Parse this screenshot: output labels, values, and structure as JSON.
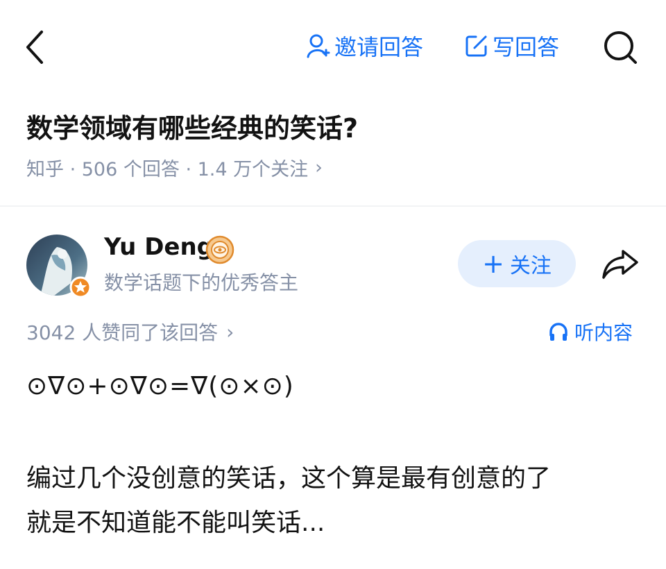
{
  "nav": {
    "invite_label": "邀请回答",
    "write_label": "写回答"
  },
  "question": {
    "title": "数学领域有哪些经典的笑话?",
    "meta": "知乎 · 506 个回答 · 1.4 万个关注",
    "meta_chevron": "›"
  },
  "author": {
    "name": "Yu Deng",
    "description": "数学话题下的优秀答主",
    "follow_label": "关注",
    "follow_plus": "+"
  },
  "answer": {
    "votes": "3042 人赞同了该回答",
    "votes_chevron": "›",
    "listen_label": "听内容",
    "formula": "⊙∇⊙+⊙∇⊙=∇(⊙×⊙)",
    "paragraph_line1": "编过几个没创意的笑话，这个算是最有创意的了",
    "paragraph_line2": "就是不知道能不能叫笑话..."
  },
  "colors": {
    "accent": "#1772f6",
    "muted_text": "#8590a6",
    "follow_bg": "#e5effd",
    "text": "#121212",
    "badge_orange": "#f08a24"
  },
  "icons": [
    "back-chevron-icon",
    "invite-person-icon",
    "edit-icon",
    "search-icon",
    "excellent-author-badge-icon",
    "verified-star-icon",
    "share-icon",
    "headphones-icon"
  ]
}
